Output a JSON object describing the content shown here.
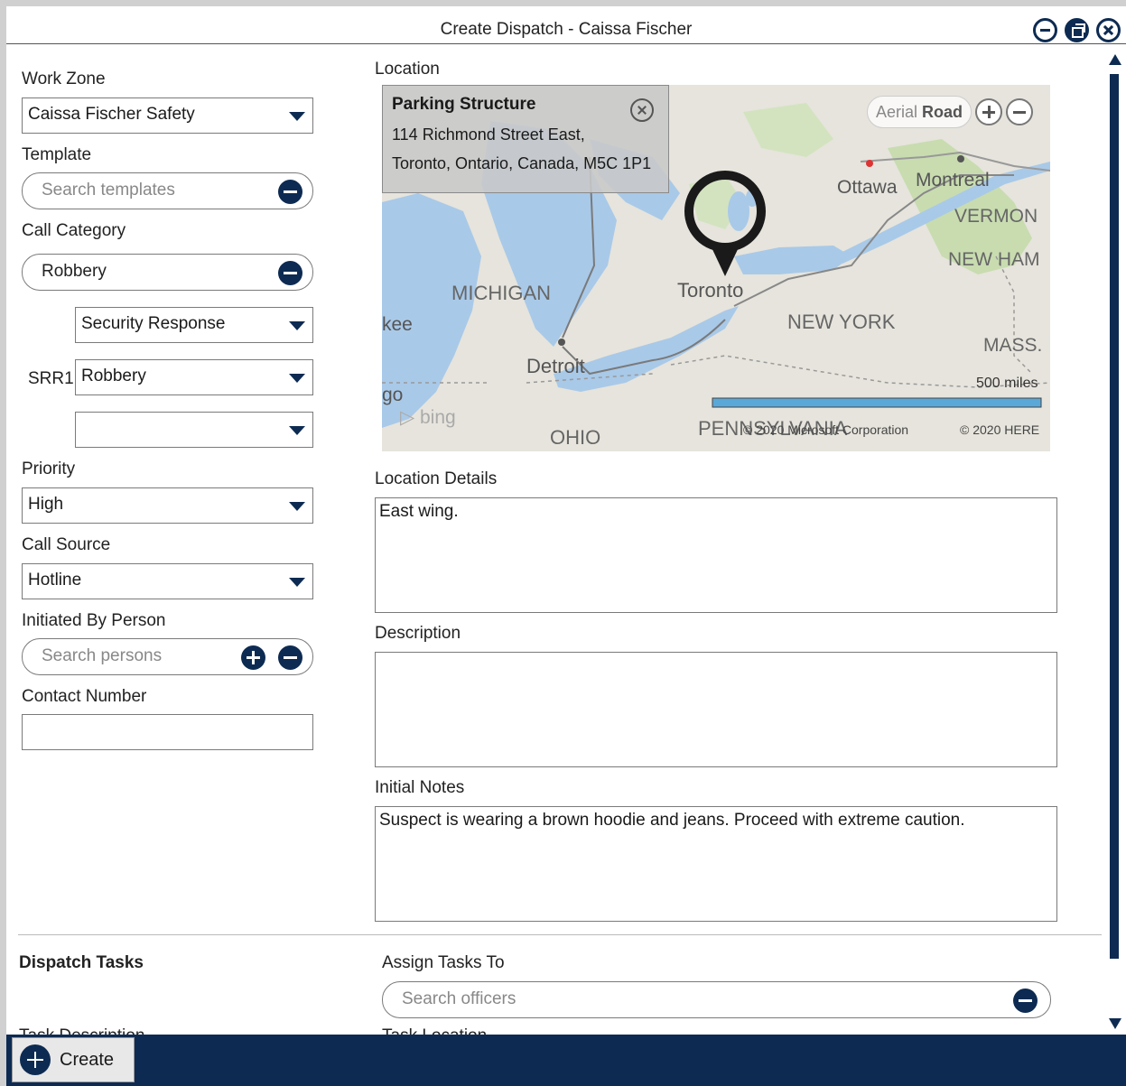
{
  "window": {
    "title": "Create Dispatch - Caissa Fischer"
  },
  "left": {
    "work_zone_label": "Work Zone",
    "work_zone_value": "Caissa Fischer Safety",
    "template_label": "Template",
    "template_placeholder": "Search templates",
    "call_category_label": "Call Category",
    "call_category_value": "Robbery",
    "category_sub1": "Security Response",
    "srr_label": "SRR1",
    "category_sub2": "Robbery",
    "category_sub3": "",
    "priority_label": "Priority",
    "priority_value": "High",
    "call_source_label": "Call Source",
    "call_source_value": "Hotline",
    "initiated_label": "Initiated By Person",
    "initiated_placeholder": "Search persons",
    "contact_label": "Contact Number",
    "contact_value": ""
  },
  "location": {
    "label": "Location",
    "popup_title": "Parking Structure",
    "popup_line1": "114 Richmond Street East,",
    "popup_line2": "Toronto, Ontario, Canada, M5C 1P1",
    "map_aerial": "Aerial",
    "map_road": "Road",
    "places": [
      "Ottawa",
      "Montreal",
      "VERMON",
      "NEW HAM",
      "MICHIGAN",
      "Toronto",
      "NEW YORK",
      "MASS.",
      "Detroit",
      "OHIO",
      "PENNSYLVANIA",
      "kee",
      "go"
    ],
    "scale_label": "500 miles",
    "copyright1": "© 2020 Microsoft Corporation",
    "copyright2": "© 2020 HERE",
    "bing": "bing"
  },
  "details": {
    "location_details_label": "Location Details",
    "location_details_value": "East wing.",
    "description_label": "Description",
    "description_value": "",
    "initial_notes_label": "Initial Notes",
    "initial_notes_value": "Suspect is wearing a brown hoodie and jeans. Proceed with extreme caution."
  },
  "tasks": {
    "title": "Dispatch Tasks",
    "assign_label": "Assign Tasks To",
    "assign_placeholder": "Search officers",
    "task_description_label": "Task Description",
    "task_location_label": "Task Location"
  },
  "footer": {
    "create_label": "Create"
  },
  "colors": {
    "accent": "#0d2b52",
    "map_water": "#a9c9e8",
    "map_land": "#e6e4dc"
  }
}
